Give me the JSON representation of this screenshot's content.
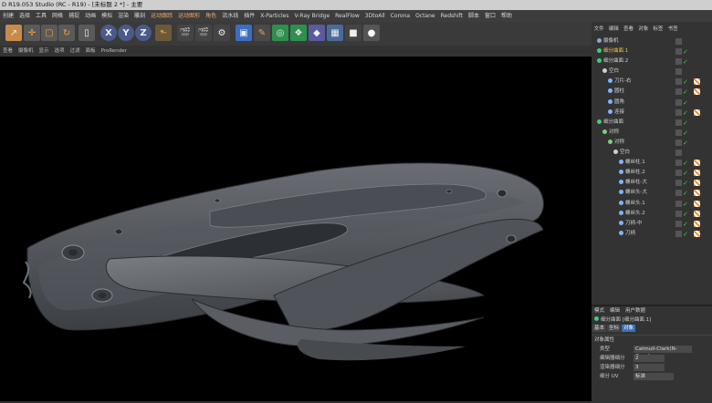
{
  "window": {
    "title": "D R19.053 Studio (RC - R19) - [未标题 2 *] - 主要"
  },
  "menu": {
    "items": [
      "创建",
      "选择",
      "工具",
      "网格",
      "捕捉",
      "动画",
      "模拟",
      "渲染",
      "雕刻",
      "运动跟踪",
      "运动图形",
      "角色",
      "流水线",
      "插件",
      "X-Particles",
      "V-Ray Bridge",
      "RealFlow",
      "3DtoAll",
      "Corona",
      "Octane",
      "Redshift",
      "脚本",
      "窗口",
      "帮助"
    ],
    "highlighted": [
      "运动跟踪",
      "运动图形",
      "角色"
    ]
  },
  "toolbar": {
    "icons": [
      "pointer-icon",
      "move-icon",
      "scale-icon",
      "rotate-icon",
      "last-tool-icon",
      "x-axis-icon",
      "y-axis-icon",
      "z-axis-icon",
      "coordinate-icon",
      "render-view-icon",
      "render-picture-viewer-icon",
      "render-settings-icon",
      "cube-icon",
      "pen-icon",
      "subdivision-icon",
      "array-icon",
      "deformer-icon",
      "floor-icon",
      "camera-icon",
      "light-icon"
    ],
    "axis_labels": [
      "X",
      "Y",
      "Z"
    ]
  },
  "viewport_menu": {
    "items": [
      "查看",
      "摄像机",
      "显示",
      "选项",
      "过滤",
      "面板",
      "ProRender"
    ]
  },
  "object_manager": {
    "tabs": [
      "文件",
      "编辑",
      "查看",
      "对象",
      "标签",
      "书签"
    ],
    "objects": [
      {
        "name": "摄像机",
        "indent": 0,
        "icon_color": "#8aa7d6",
        "check": false,
        "tag": false
      },
      {
        "name": "细分曲面.1",
        "indent": 0,
        "icon_color": "#3fcf6f",
        "check": true,
        "tag": false,
        "highlight": true
      },
      {
        "name": "细分曲面.2",
        "indent": 0,
        "icon_color": "#3fcf6f",
        "check": true,
        "tag": false
      },
      {
        "name": "空白",
        "indent": 1,
        "icon_color": "#cfcfcf",
        "check": false,
        "tag": false
      },
      {
        "name": "刀片-右",
        "indent": 2,
        "icon_color": "#7fb3ff",
        "check": true,
        "tag": true
      },
      {
        "name": "圆柱",
        "indent": 2,
        "icon_color": "#7fb3ff",
        "check": true,
        "tag": true
      },
      {
        "name": "圆角",
        "indent": 2,
        "icon_color": "#7fb3ff",
        "check": true,
        "tag": false
      },
      {
        "name": "连接",
        "indent": 2,
        "icon_color": "#7fb3ff",
        "check": true,
        "tag": true
      },
      {
        "name": "细分曲面",
        "indent": 0,
        "icon_color": "#3fcf6f",
        "check": true,
        "tag": false
      },
      {
        "name": "对称",
        "indent": 1,
        "icon_color": "#7ad07a",
        "check": true,
        "tag": false
      },
      {
        "name": "对称",
        "indent": 2,
        "icon_color": "#7ad07a",
        "check": true,
        "tag": false
      },
      {
        "name": "空白",
        "indent": 3,
        "icon_color": "#cfcfcf",
        "check": false,
        "tag": false
      },
      {
        "name": "螺丝柱.1",
        "indent": 4,
        "icon_color": "#7fb3ff",
        "check": true,
        "tag": true
      },
      {
        "name": "螺丝柱.2",
        "indent": 4,
        "icon_color": "#7fb3ff",
        "check": true,
        "tag": true
      },
      {
        "name": "螺丝柱-大",
        "indent": 4,
        "icon_color": "#7fb3ff",
        "check": true,
        "tag": true
      },
      {
        "name": "螺丝头-大",
        "indent": 4,
        "icon_color": "#7fb3ff",
        "check": true,
        "tag": true
      },
      {
        "name": "螺丝头.1",
        "indent": 4,
        "icon_color": "#7fb3ff",
        "check": true,
        "tag": true
      },
      {
        "name": "螺丝头.2",
        "indent": 4,
        "icon_color": "#7fb3ff",
        "check": true,
        "tag": true
      },
      {
        "name": "刀柄-中",
        "indent": 4,
        "icon_color": "#7fb3ff",
        "check": true,
        "tag": true
      },
      {
        "name": "刀柄",
        "indent": 4,
        "icon_color": "#7fb3ff",
        "check": true,
        "tag": true
      }
    ]
  },
  "attributes": {
    "tabs": [
      "模式",
      "编辑",
      "用户数据"
    ],
    "title": "细分曲面 [细分曲面.1]",
    "subtabs": [
      "基本",
      "坐标",
      "对象"
    ],
    "active_subtab": "对象",
    "section": "对象属性",
    "rows": [
      {
        "label": "类型",
        "value": "Catmull-Clark(N-Gons)"
      },
      {
        "label": "编辑器细分",
        "value": "2"
      },
      {
        "label": "渲染器细分",
        "value": "3"
      },
      {
        "label": "细分 UV",
        "value": "标准"
      }
    ]
  },
  "colors": {
    "accent_orange": "#f2a86a",
    "selection_blue": "#3b6fb6",
    "visible_green": "#3fcf3f"
  }
}
